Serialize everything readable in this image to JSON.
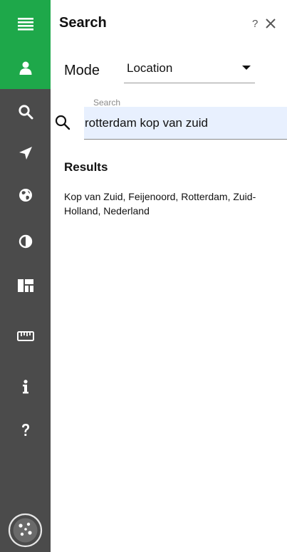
{
  "sidebar": {
    "items": [
      {
        "name": "menu-icon",
        "active": true
      },
      {
        "name": "user-icon",
        "active": true
      },
      {
        "name": "search-icon",
        "active": false
      },
      {
        "name": "navigate-arrow-icon",
        "active": false
      },
      {
        "name": "globe-icon",
        "active": false
      },
      {
        "name": "contrast-icon",
        "active": false
      },
      {
        "name": "layout-icon",
        "active": false
      },
      {
        "name": "ruler-icon",
        "active": false
      },
      {
        "name": "info-icon",
        "active": false
      },
      {
        "name": "help-icon",
        "active": false
      }
    ],
    "logo": "app-logo-icon",
    "accent": "#1ea84a",
    "background": "#4b4b4b"
  },
  "panel": {
    "title": "Search",
    "help_label": "?",
    "close_icon": "close-icon"
  },
  "mode": {
    "label": "Mode",
    "selected": "Location"
  },
  "search": {
    "caption": "Search",
    "value": "rotterdam kop van zuid",
    "placeholder": ""
  },
  "results": {
    "title": "Results",
    "items": [
      {
        "text": "Kop van Zuid, Feijenoord, Rotterdam, Zuid-Holland, Nederland"
      }
    ]
  }
}
